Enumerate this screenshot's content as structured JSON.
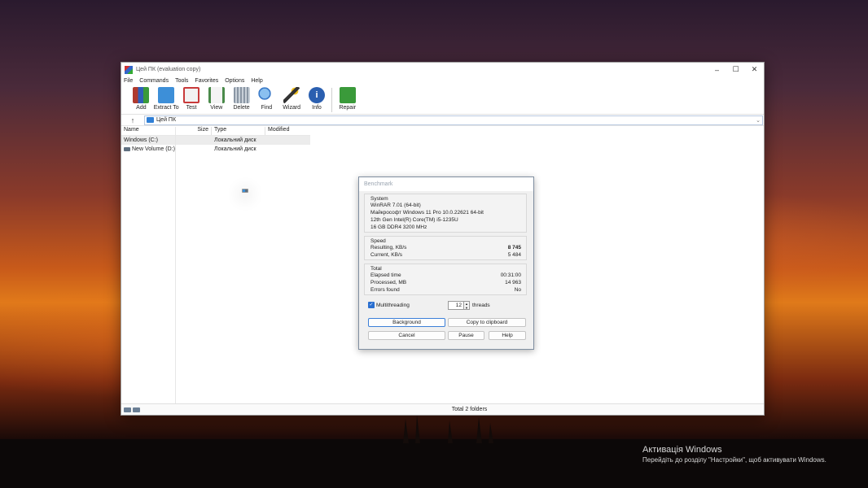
{
  "desktop": {
    "activation_title": "Активація Windows",
    "activation_sub": "Перейдіть до розділу \"Настройки\", щоб активувати Windows."
  },
  "window": {
    "title": "Цей ПК (evaluation copy)",
    "controls": {
      "minimize": "–",
      "maximize": "☐",
      "close": "✕"
    },
    "menu": [
      "File",
      "Commands",
      "Tools",
      "Favorites",
      "Options",
      "Help"
    ],
    "toolbar": [
      {
        "label": "Add",
        "icon": "add-archive-icon",
        "color": "#b03a2e"
      },
      {
        "label": "Extract To",
        "icon": "extract-folder-icon",
        "color": "#3d8fd8"
      },
      {
        "label": "Test",
        "icon": "test-icon",
        "color": "#c83a3a"
      },
      {
        "label": "View",
        "icon": "view-book-icon",
        "color": "#4a8a4a"
      },
      {
        "label": "Delete",
        "icon": "trash-icon",
        "color": "#8a96a4"
      },
      {
        "label": "Find",
        "icon": "magnifier-icon",
        "color": "#3a7ac8"
      },
      {
        "label": "Wizard",
        "icon": "wand-icon",
        "color": "#d8a020"
      },
      {
        "label": "Info",
        "icon": "info-icon",
        "color": "#2a5fb0"
      },
      {
        "label": "Repair",
        "icon": "repair-kit-icon",
        "color": "#3a9a3a"
      }
    ],
    "address": {
      "up": "↑",
      "path": "Цей ПК",
      "dropdown": "⌄"
    },
    "columns": {
      "name": "Name",
      "size": "Size",
      "type": "Type",
      "modified": "Modified"
    },
    "rows": [
      {
        "name": "Windows (C:)",
        "size": "",
        "type": "Локальний диск"
      },
      {
        "name": "New Volume (D:)",
        "size": "",
        "type": "Локальний диск"
      }
    ],
    "status": "Total 2 folders"
  },
  "dialog": {
    "title": "Benchmark",
    "system": {
      "heading": "System",
      "lines": [
        "WinRAR 7.01 (64-bit)",
        "Майкрософт Windows 11 Pro 10.0.22621 64-bit",
        "12th Gen Intel(R) Core(TM) i5-1235U",
        "16 GB DDR4 3200 MHz"
      ]
    },
    "speed": {
      "heading": "Speed",
      "resulting_label": "Resulting, KB/s",
      "resulting_value": "8 745",
      "current_label": "Current, KB/s",
      "current_value": "5 484"
    },
    "total": {
      "heading": "Total",
      "elapsed_label": "Elapsed time",
      "elapsed_value": "00:31:00",
      "processed_label": "Processed, MB",
      "processed_value": "14 963",
      "errors_label": "Errors found",
      "errors_value": "No"
    },
    "multithreading_label": "Multithreading",
    "multithreading_checked": true,
    "threads_value": "12",
    "threads_label": "threads",
    "buttons": {
      "background": "Background",
      "copy": "Copy to clipboard",
      "cancel": "Cancel",
      "pause": "Pause",
      "help": "Help"
    }
  }
}
